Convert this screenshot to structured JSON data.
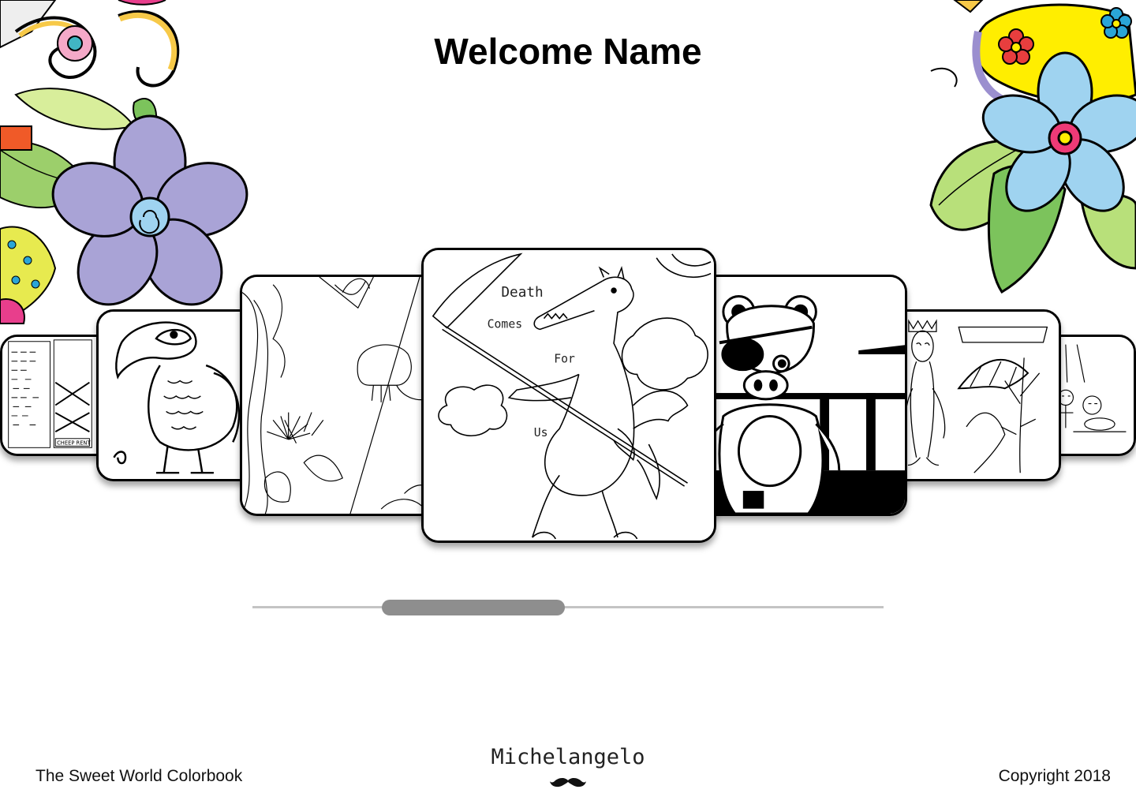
{
  "page": {
    "title": "Welcome Name"
  },
  "carousel": {
    "items": [
      {
        "name": "city-street-drawing"
      },
      {
        "name": "toucan-drawing"
      },
      {
        "name": "coral-reef-drawing"
      },
      {
        "name": "dragon-reaper-drawing",
        "caption": [
          "Death",
          "Comes",
          "For",
          "Us"
        ]
      },
      {
        "name": "pirate-bear-drawing"
      },
      {
        "name": "alien-king-drawing"
      },
      {
        "name": "skeleton-feast-drawing"
      }
    ],
    "scroll_position_percent": 29
  },
  "footer": {
    "app_name": "The Sweet World Colorbook",
    "brand": "Michelangelo",
    "copyright": "Copyright 2018"
  },
  "colors": {
    "slider_track": "#c4c4c4",
    "slider_thumb": "#8e8e8e",
    "flower_purple": "#a9a3d6",
    "flower_blue": "#9fd3f0",
    "leaf_green": "#9ccf6b",
    "petal_yellow": "#ffee00",
    "accent_pink": "#ee3a76"
  }
}
